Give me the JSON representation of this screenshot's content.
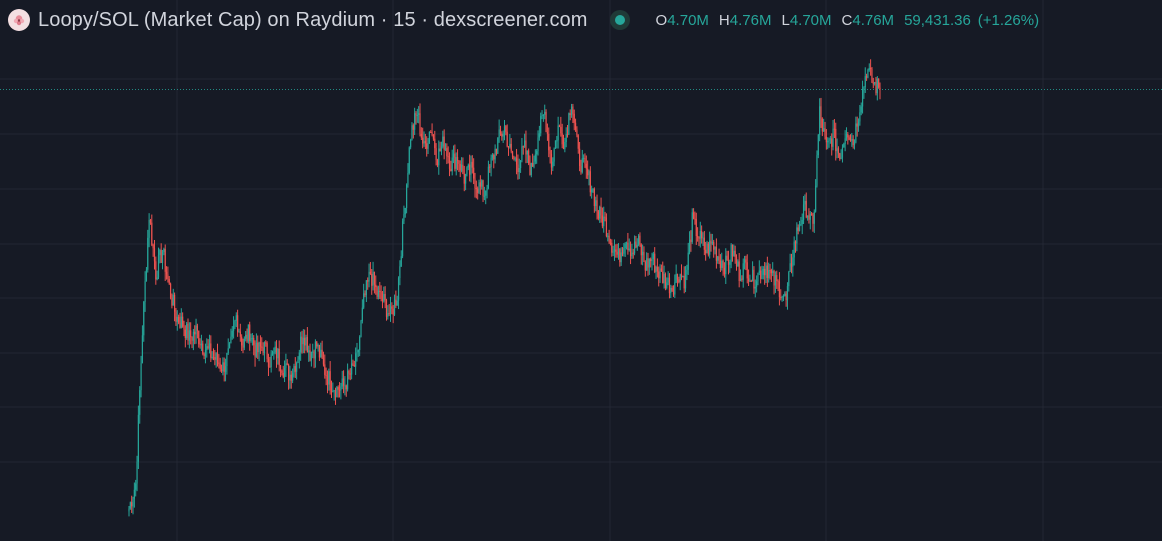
{
  "header": {
    "logo_icon": "loopy-token-logo",
    "title": "Loopy/SOL (Market Cap) on Raydium · 15 · dexscreener.com",
    "status": "live",
    "ohlc": [
      {
        "key": "O",
        "value": "4.70M"
      },
      {
        "key": "H",
        "value": "4.76M"
      },
      {
        "key": "L",
        "value": "4.70M"
      },
      {
        "key": "C",
        "value": "4.76M"
      }
    ],
    "change_price": "59,431.36",
    "change_pct": "(+1.26%)"
  },
  "colors": {
    "background": "#161a25",
    "grid": "#232733",
    "up": "#26a69a",
    "down": "#ef5350",
    "price_line": "#26a69a"
  },
  "chart_data": {
    "type": "candlestick",
    "title": "Loopy/SOL (Market Cap) on Raydium · 15 · dexscreener.com",
    "interval": "15",
    "units": "market cap (USD)",
    "ylim": [
      1.8,
      5.1
    ],
    "grid": true,
    "last_close": 4.76,
    "path_close": [
      1.88,
      2.05,
      3.1,
      3.9,
      3.5,
      3.65,
      3.4,
      3.2,
      3.15,
      3.05,
      3.1,
      3.0,
      2.95,
      2.9,
      2.85,
      2.95,
      3.2,
      3.0,
      3.1,
      2.95,
      3.0,
      2.9,
      2.95,
      2.85,
      2.8,
      2.9,
      3.1,
      2.95,
      3.0,
      2.85,
      2.75,
      2.7,
      2.72,
      2.8,
      2.9,
      3.3,
      3.5,
      3.35,
      3.3,
      3.2,
      3.35,
      3.9,
      4.45,
      4.6,
      4.35,
      4.5,
      4.3,
      4.4,
      4.25,
      4.3,
      4.15,
      4.2,
      4.1,
      4.05,
      4.25,
      4.4,
      4.5,
      4.3,
      4.25,
      4.35,
      4.2,
      4.45,
      4.6,
      4.25,
      4.5,
      4.4,
      4.7,
      4.3,
      4.2,
      4.1,
      3.9,
      3.85,
      3.7,
      3.6,
      3.75,
      3.65,
      3.7,
      3.55,
      3.6,
      3.5,
      3.45,
      3.4,
      3.5,
      3.45,
      3.85,
      3.75,
      3.65,
      3.7,
      3.6,
      3.55,
      3.65,
      3.5,
      3.55,
      3.45,
      3.5,
      3.55,
      3.45,
      3.4,
      3.3,
      3.65,
      3.85,
      3.95,
      3.8,
      4.6,
      4.35,
      4.45,
      4.3,
      4.5,
      4.4,
      4.65,
      4.9,
      4.8,
      4.76
    ]
  }
}
